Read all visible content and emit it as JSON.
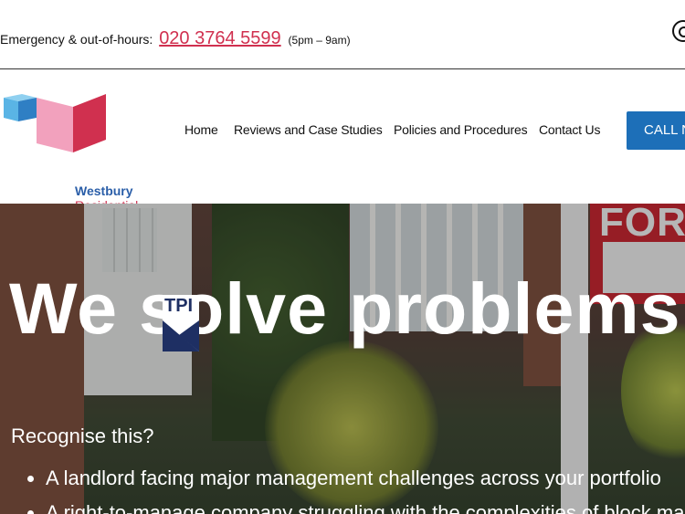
{
  "topbar": {
    "emergency_label": "Emergency & out-of-hours:",
    "phone": "020 3764 5599",
    "hours": "(5pm – 9am)",
    "icon": "whatsapp-icon"
  },
  "brand": {
    "name_line1": "Westbury",
    "name_line2": "Residential",
    "colors": {
      "blue": "#2a5ea8",
      "pink": "#d0304f",
      "light_blue": "#5ab4e5",
      "light_pink": "#f2a1bd"
    }
  },
  "nav": {
    "items": [
      "Home",
      "Reviews and Case Studies",
      "Policies and Procedures",
      "Contact Us"
    ],
    "cta_label": "CALL N"
  },
  "hero": {
    "headline": "We solve problems",
    "badge_text": "TPI",
    "subheading": "Recognise this?",
    "bullets": [
      "A landlord facing major management challenges across your portfolio",
      "A right-to-manage company struggling with the complexities of block man"
    ],
    "sign_text": "FOR"
  }
}
